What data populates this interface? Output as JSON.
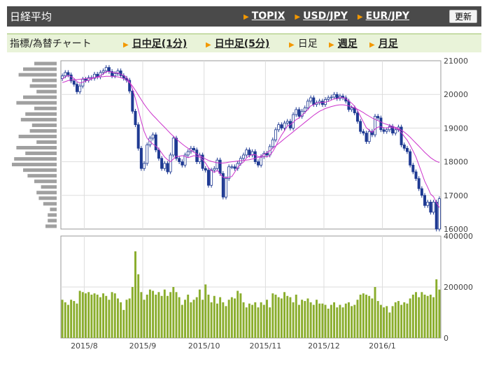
{
  "header": {
    "title": "日経平均",
    "links": [
      "TOPIX",
      "USD/JPY",
      "EUR/JPY"
    ],
    "refresh_label": "更新"
  },
  "tabs": {
    "indicator_label": "指標/為替チャート",
    "items": [
      {
        "label": "日中足(1分)",
        "link": true
      },
      {
        "label": "日中足(5分)",
        "link": true
      },
      {
        "label": "日足",
        "link": false
      },
      {
        "label": "週足",
        "link": true
      },
      {
        "label": "月足",
        "link": true
      }
    ]
  },
  "colors": {
    "up": "#ffffff",
    "down": "#1f3a93",
    "ma": "#cc33cc",
    "volume": "#8aad2c",
    "volume_profile": "#a0a0a0"
  },
  "chart_data": [
    {
      "type": "candlestick",
      "title": "",
      "x_labels": [
        "2015/8",
        "2015/9",
        "2015/10",
        "2015/11",
        "2015/12",
        "2016/1"
      ],
      "x_label_index": [
        8,
        28,
        49,
        70,
        90,
        110
      ],
      "y_ticks": [
        16000,
        17000,
        18000,
        19000,
        20000,
        21000
      ],
      "ylim": [
        16000,
        21000
      ],
      "close": [
        20550,
        20650,
        20580,
        20400,
        20300,
        20080,
        20250,
        20450,
        20420,
        20500,
        20480,
        20600,
        20520,
        20650,
        20700,
        20800,
        20680,
        20550,
        20620,
        20700,
        20560,
        20480,
        20420,
        20100,
        19500,
        19100,
        18400,
        17800,
        17950,
        18500,
        18700,
        18800,
        18350,
        18100,
        17800,
        17950,
        17700,
        18200,
        18700,
        18100,
        18000,
        17900,
        18200,
        18300,
        18400,
        18350,
        18000,
        18200,
        17800,
        17750,
        17300,
        17750,
        17800,
        18050,
        17650,
        16950,
        17500,
        17850,
        17850,
        17800,
        17950,
        18100,
        18200,
        18350,
        18200,
        18300,
        18000,
        17900,
        18150,
        18250,
        18200,
        18450,
        18650,
        18950,
        19100,
        19000,
        19150,
        19200,
        19000,
        19400,
        19550,
        19350,
        19500,
        19600,
        19800,
        19900,
        19700,
        19750,
        19800,
        19700,
        19850,
        19900,
        19920,
        20000,
        19880,
        19950,
        19900,
        19800,
        19550,
        19600,
        19450,
        19200,
        18900,
        18850,
        18600,
        18900,
        18800,
        19350,
        19300,
        18950,
        18900,
        18950,
        19050,
        18850,
        18950,
        19030,
        18500,
        18400,
        18300,
        17900,
        17700,
        17500,
        17200,
        17000,
        16700,
        16800,
        16500,
        16800,
        16000,
        16900
      ],
      "ma_short": [
        20450,
        20520,
        20560,
        20530,
        20480,
        20380,
        20340,
        20360,
        20400,
        20420,
        20460,
        20500,
        20520,
        20560,
        20610,
        20670,
        20680,
        20660,
        20640,
        20640,
        20600,
        20560,
        20500,
        20380,
        20160,
        19880,
        19540,
        19200,
        18900,
        18700,
        18600,
        18520,
        18460,
        18380,
        18260,
        18140,
        18060,
        18000,
        18080,
        18160,
        18160,
        18180,
        18160,
        18120,
        18150,
        18180,
        18160,
        18140,
        18060,
        17960,
        17820,
        17740,
        17680,
        17740,
        17640,
        17540,
        17520,
        17540,
        17560,
        17690,
        17830,
        17930,
        17990,
        18110,
        18180,
        18210,
        18210,
        18150,
        18130,
        18160,
        18140,
        18190,
        18300,
        18450,
        18640,
        18790,
        18920,
        19060,
        19100,
        19170,
        19250,
        19300,
        19380,
        19460,
        19550,
        19660,
        19690,
        19750,
        19760,
        19760,
        19770,
        19790,
        19830,
        19870,
        19870,
        19910,
        19900,
        19880,
        19800,
        19740,
        19650,
        19520,
        19350,
        19180,
        19010,
        18940,
        18870,
        18970,
        19030,
        19040,
        19010,
        19000,
        19030,
        19010,
        18990,
        18960,
        18870,
        18750,
        18640,
        18490,
        18320,
        18140,
        17900,
        17660,
        17420,
        17240,
        17040,
        16960,
        16780,
        16640
      ],
      "ma_long": [
        20350,
        20380,
        20410,
        20430,
        20440,
        20440,
        20450,
        20460,
        20470,
        20480,
        20490,
        20500,
        20510,
        20520,
        20530,
        20540,
        20540,
        20540,
        20530,
        20520,
        20500,
        20470,
        20420,
        20350,
        20250,
        20120,
        19980,
        19840,
        19710,
        19590,
        19480,
        19380,
        19290,
        19200,
        19110,
        19020,
        18930,
        18840,
        18760,
        18680,
        18600,
        18530,
        18460,
        18400,
        18340,
        18280,
        18230,
        18180,
        18130,
        18080,
        18040,
        18010,
        17990,
        17970,
        17960,
        17960,
        17970,
        17990,
        18000,
        18010,
        18020,
        18030,
        18040,
        18050,
        18060,
        18080,
        18100,
        18130,
        18170,
        18220,
        18270,
        18330,
        18400,
        18470,
        18540,
        18610,
        18680,
        18750,
        18820,
        18890,
        18960,
        19030,
        19100,
        19170,
        19240,
        19310,
        19380,
        19440,
        19500,
        19540,
        19580,
        19610,
        19640,
        19660,
        19680,
        19690,
        19690,
        19680,
        19660,
        19630,
        19600,
        19560,
        19510,
        19460,
        19400,
        19350,
        19300,
        19260,
        19220,
        19180,
        19140,
        19110,
        19080,
        19050,
        19020,
        18990,
        18940,
        18880,
        18810,
        18730,
        18640,
        18550,
        18460,
        18370,
        18280,
        18200,
        18120,
        18060,
        18010,
        17980
      ]
    },
    {
      "type": "bar",
      "title": "",
      "y_ticks": [
        0,
        200000,
        400000
      ],
      "ylim": [
        0,
        400000
      ],
      "values": [
        150000,
        140000,
        130000,
        150000,
        145000,
        135000,
        185000,
        180000,
        175000,
        180000,
        170000,
        175000,
        170000,
        160000,
        175000,
        165000,
        150000,
        180000,
        175000,
        155000,
        140000,
        110000,
        150000,
        155000,
        200000,
        340000,
        250000,
        180000,
        150000,
        170000,
        190000,
        185000,
        170000,
        180000,
        165000,
        190000,
        165000,
        180000,
        200000,
        180000,
        160000,
        130000,
        150000,
        170000,
        140000,
        150000,
        160000,
        190000,
        150000,
        210000,
        170000,
        140000,
        165000,
        135000,
        160000,
        140000,
        125000,
        150000,
        160000,
        155000,
        185000,
        175000,
        140000,
        120000,
        135000,
        130000,
        140000,
        120000,
        140000,
        130000,
        150000,
        120000,
        175000,
        170000,
        160000,
        155000,
        180000,
        165000,
        160000,
        140000,
        170000,
        130000,
        150000,
        145000,
        155000,
        140000,
        130000,
        150000,
        135000,
        135000,
        130000,
        115000,
        130000,
        140000,
        120000,
        130000,
        120000,
        135000,
        140000,
        125000,
        130000,
        150000,
        170000,
        175000,
        170000,
        165000,
        155000,
        200000,
        145000,
        130000,
        120000,
        125000,
        100000,
        125000,
        140000,
        145000,
        130000,
        140000,
        135000,
        155000,
        170000,
        180000,
        160000,
        180000,
        170000,
        165000,
        170000,
        160000,
        230000,
        190000
      ]
    },
    {
      "type": "bar",
      "title": "",
      "orientation": "horizontal",
      "values": [
        0.5,
        0.75,
        0.85,
        0.55,
        0.6,
        0.45,
        0.75,
        0.9,
        0.5,
        0.7,
        0.8,
        0.55,
        0.6,
        0.85,
        0.45,
        0.9,
        0.7,
        0.95,
        1.0,
        0.75,
        0.65,
        0.5,
        0.35,
        0.45,
        0.4,
        0.3,
        0.15,
        0.2,
        0.2,
        0.25
      ]
    }
  ]
}
